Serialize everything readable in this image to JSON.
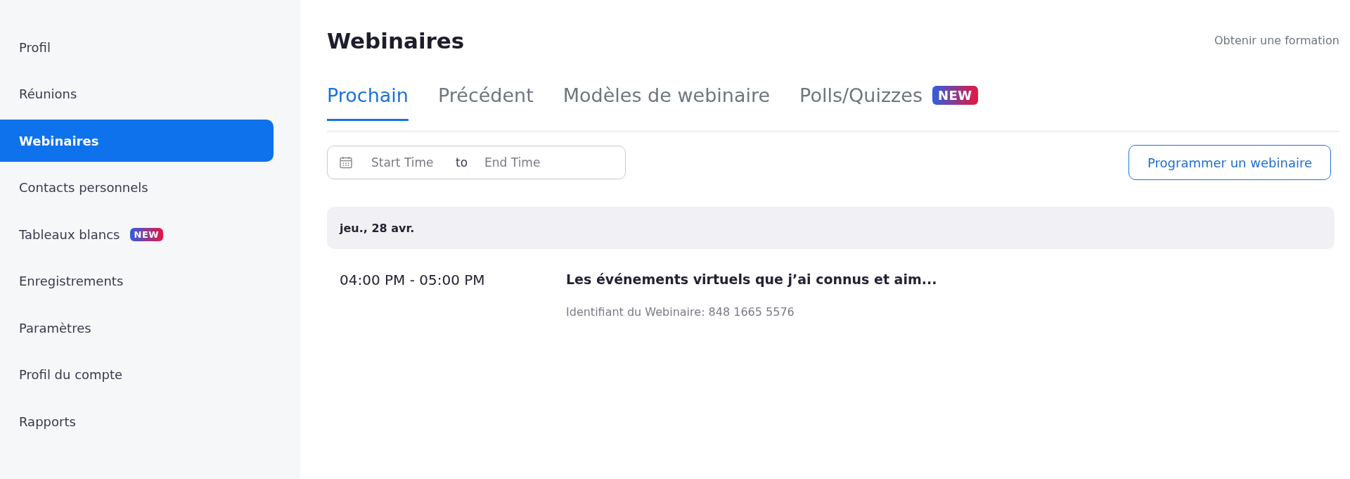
{
  "sidebar": {
    "items": [
      {
        "label": "Profil",
        "selected": false
      },
      {
        "label": "Réunions",
        "selected": false
      },
      {
        "label": "Webinaires",
        "selected": true
      },
      {
        "label": "Contacts personnels",
        "selected": false
      },
      {
        "label": "Tableaux blancs",
        "selected": false,
        "badge": "NEW"
      },
      {
        "label": "Enregistrements",
        "selected": false
      },
      {
        "label": "Paramètres",
        "selected": false
      },
      {
        "label": "Profil du compte",
        "selected": false
      },
      {
        "label": "Rapports",
        "selected": false
      }
    ]
  },
  "page": {
    "title": "Webinaires",
    "training_link": "Obtenir une formation"
  },
  "tabs": [
    {
      "label": "Prochain",
      "selected": true
    },
    {
      "label": "Précédent",
      "selected": false
    },
    {
      "label": "Modèles de webinaire",
      "selected": false
    },
    {
      "label": "Polls/Quizzes",
      "selected": false,
      "badge": "NEW"
    }
  ],
  "date_range": {
    "start_placeholder": "Start Time",
    "separator": "to",
    "end_placeholder": "End Time"
  },
  "schedule_button": "Programmer un webinaire",
  "groups": [
    {
      "date": "jeu., 28 avr.",
      "webinars": [
        {
          "time": "04:00 PM - 05:00 PM",
          "title": "Les événements virtuels que j’ai connus et aim...",
          "id_text": "Identifiant du Webinaire: 848 1665 5576"
        }
      ]
    }
  ]
}
